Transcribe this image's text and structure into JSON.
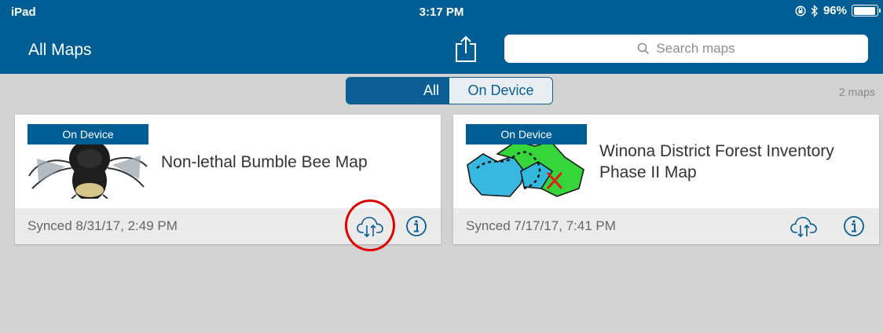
{
  "status_bar": {
    "carrier": "iPad",
    "time": "3:17 PM",
    "battery_text": "96%",
    "battery_level": 0.96,
    "icons": [
      "orientation-lock-icon",
      "bluetooth-icon",
      "battery-icon"
    ]
  },
  "nav": {
    "title": "All Maps",
    "share_icon": "share-icon",
    "search_placeholder": "Search maps",
    "search_icon": "search-icon"
  },
  "filter": {
    "options": [
      "All",
      "On Device"
    ],
    "selected": "All",
    "count_text": "2 maps"
  },
  "maps": [
    {
      "badge": "On Device",
      "title": "Non-lethal Bumble Bee Map",
      "synced": "Synced 8/31/17, 2:49 PM",
      "thumbnail": "bumble-bee-thumbnail",
      "sync_icon": "cloud-sync-icon",
      "info_icon": "info-icon"
    },
    {
      "badge": "On Device",
      "title": "Winona District Forest Inventory Phase II Map",
      "synced": "Synced 7/17/17, 7:41 PM",
      "thumbnail": "forest-map-thumbnail",
      "sync_icon": "cloud-sync-icon",
      "info_icon": "info-icon"
    }
  ],
  "colors": {
    "brand_blue": "#005e95",
    "background": "#d2d2d2",
    "highlight_red": "#e00000"
  }
}
